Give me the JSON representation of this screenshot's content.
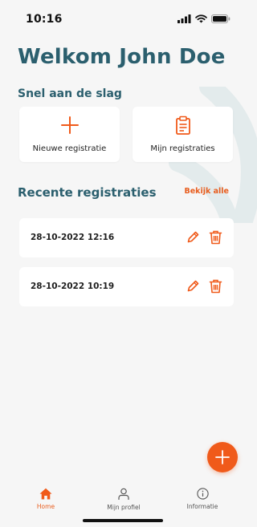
{
  "status_bar": {
    "time": "10:16"
  },
  "header": {
    "welcome": "Welkom John Doe"
  },
  "quick_start": {
    "title": "Snel aan de slag",
    "new_registration_label": "Nieuwe registratie",
    "my_registrations_label": "Mijn registraties"
  },
  "recent": {
    "title": "Recente registraties",
    "see_all_label": "Bekijk alle",
    "items": [
      {
        "datetime": "28-10-2022 12:16"
      },
      {
        "datetime": "28-10-2022 10:19"
      }
    ]
  },
  "tabbar": {
    "home_label": "Home",
    "profile_label": "Mijn profiel",
    "info_label": "Informatie"
  },
  "colors": {
    "accent": "#f05a1a",
    "heading": "#2b5f6e",
    "background": "#f6f6f6"
  },
  "icons": [
    "signal-icon",
    "wifi-icon",
    "battery-icon",
    "plus-icon",
    "clipboard-icon",
    "pencil-icon",
    "trash-icon",
    "home-icon",
    "person-icon",
    "info-icon"
  ]
}
